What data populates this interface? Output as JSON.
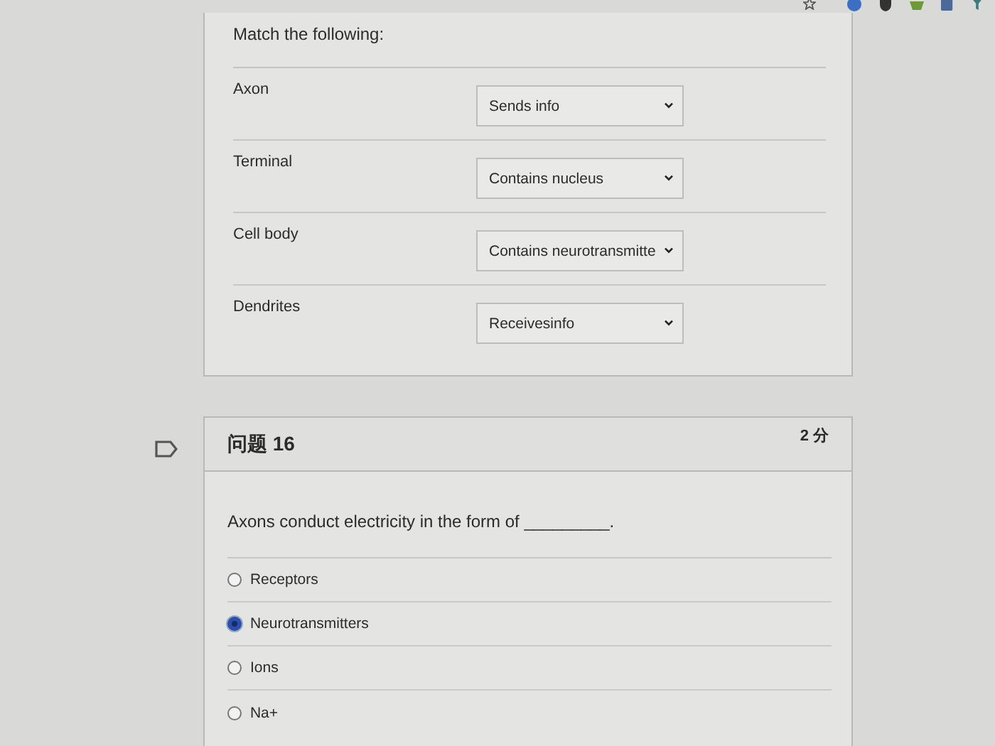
{
  "matching": {
    "prompt": "Match the following:",
    "pairs": [
      {
        "term": "Axon",
        "answer": "Sends info"
      },
      {
        "term": "Terminal",
        "answer": "Contains nucleus"
      },
      {
        "term": "Cell body",
        "answer": "Contains neurotransmitte"
      },
      {
        "term": "Dendrites",
        "answer": "Receivesinfo"
      }
    ]
  },
  "question": {
    "title": "问题 16",
    "points": "2 分",
    "flagged": false,
    "text": "Axons conduct electricity in the form of _________.",
    "options": [
      {
        "label": "Receptors",
        "selected": false
      },
      {
        "label": "Neurotransmitters",
        "selected": true
      },
      {
        "label": "Ions",
        "selected": false
      },
      {
        "label": "Na+",
        "selected": false
      }
    ]
  }
}
